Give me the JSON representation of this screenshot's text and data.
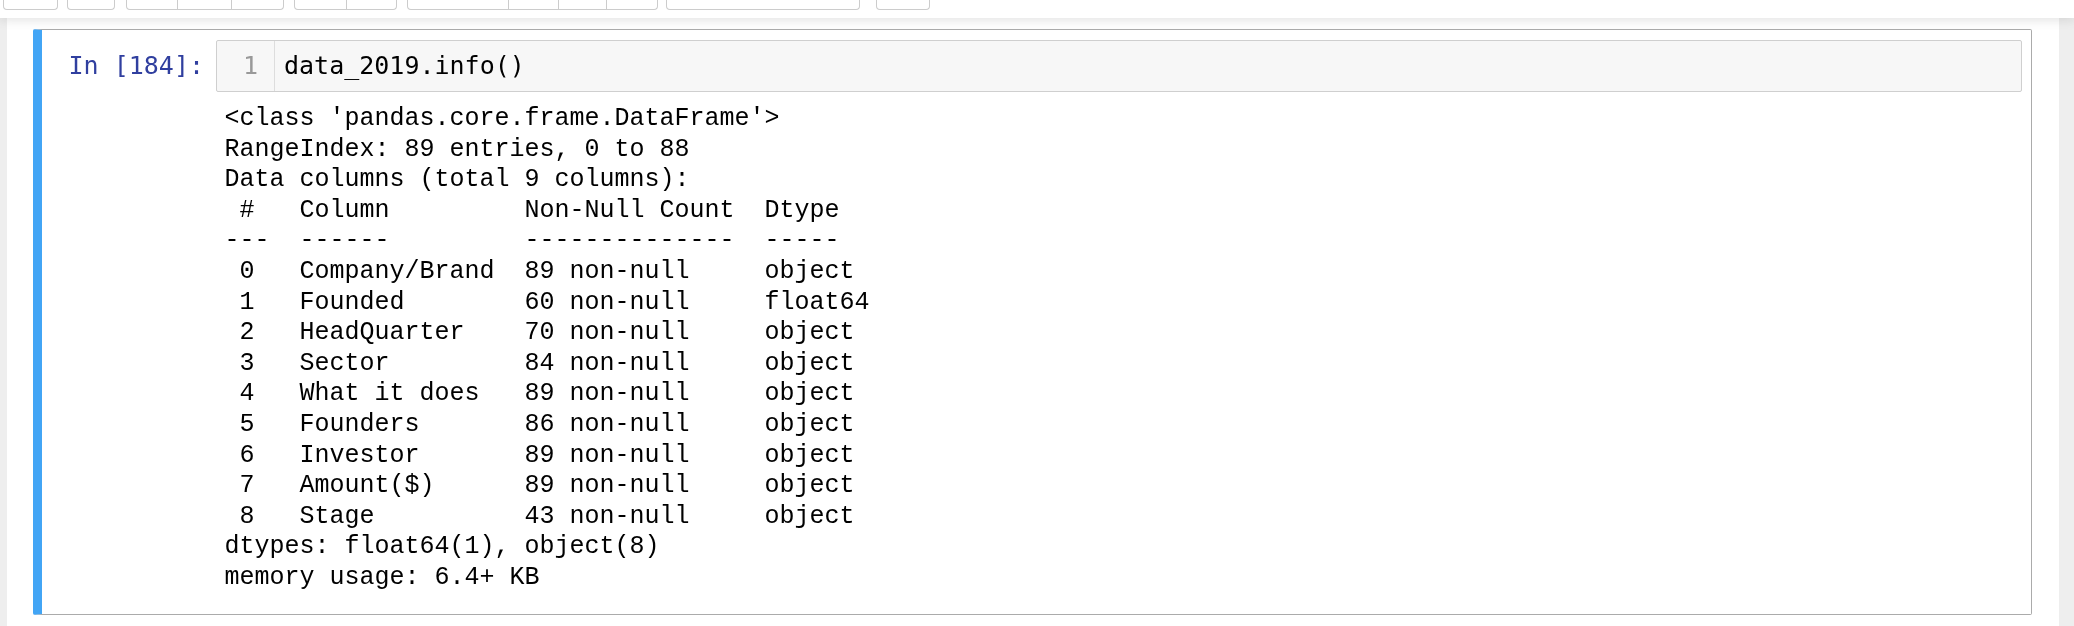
{
  "toolbar": {
    "groups": [
      {
        "items": [
          {
            "kind": "button"
          }
        ]
      },
      {
        "items": [
          {
            "kind": "button"
          }
        ]
      },
      {
        "items": [
          {
            "kind": "button"
          },
          {
            "kind": "button"
          },
          {
            "kind": "button"
          }
        ]
      },
      {
        "items": [
          {
            "kind": "button"
          },
          {
            "kind": "button"
          }
        ]
      },
      {
        "items": [
          {
            "kind": "button"
          },
          {
            "kind": "button"
          },
          {
            "kind": "button"
          },
          {
            "kind": "button"
          }
        ]
      },
      {
        "items": [
          {
            "kind": "dropdown"
          }
        ]
      },
      {
        "items": [
          {
            "kind": "button"
          }
        ]
      }
    ]
  },
  "cell": {
    "selected": true,
    "prompt": "In [184]:",
    "input": {
      "lines": [
        {
          "number": "1",
          "code": "data_2019.info()"
        }
      ]
    },
    "output": {
      "header": [
        "<class 'pandas.core.frame.DataFrame'>",
        "RangeIndex: 89 entries, 0 to 88",
        "Data columns (total 9 columns):"
      ],
      "table": {
        "columns": [
          "#",
          "Column",
          "Non-Null Count",
          "Dtype"
        ],
        "rules": [
          "---",
          "------",
          "--------------",
          "-----"
        ],
        "rows": [
          [
            "0",
            "Company/Brand",
            "89 non-null",
            "object"
          ],
          [
            "1",
            "Founded",
            "60 non-null",
            "float64"
          ],
          [
            "2",
            "HeadQuarter",
            "70 non-null",
            "object"
          ],
          [
            "3",
            "Sector",
            "84 non-null",
            "object"
          ],
          [
            "4",
            "What it does",
            "89 non-null",
            "object"
          ],
          [
            "5",
            "Founders",
            "86 non-null",
            "object"
          ],
          [
            "6",
            "Investor",
            "89 non-null",
            "object"
          ],
          [
            "7",
            "Amount($)",
            "89 non-null",
            "object"
          ],
          [
            "8",
            "Stage",
            "43 non-null",
            "object"
          ]
        ]
      },
      "footer": [
        "dtypes: float64(1), object(8)",
        "memory usage: 6.4+ KB"
      ]
    }
  }
}
